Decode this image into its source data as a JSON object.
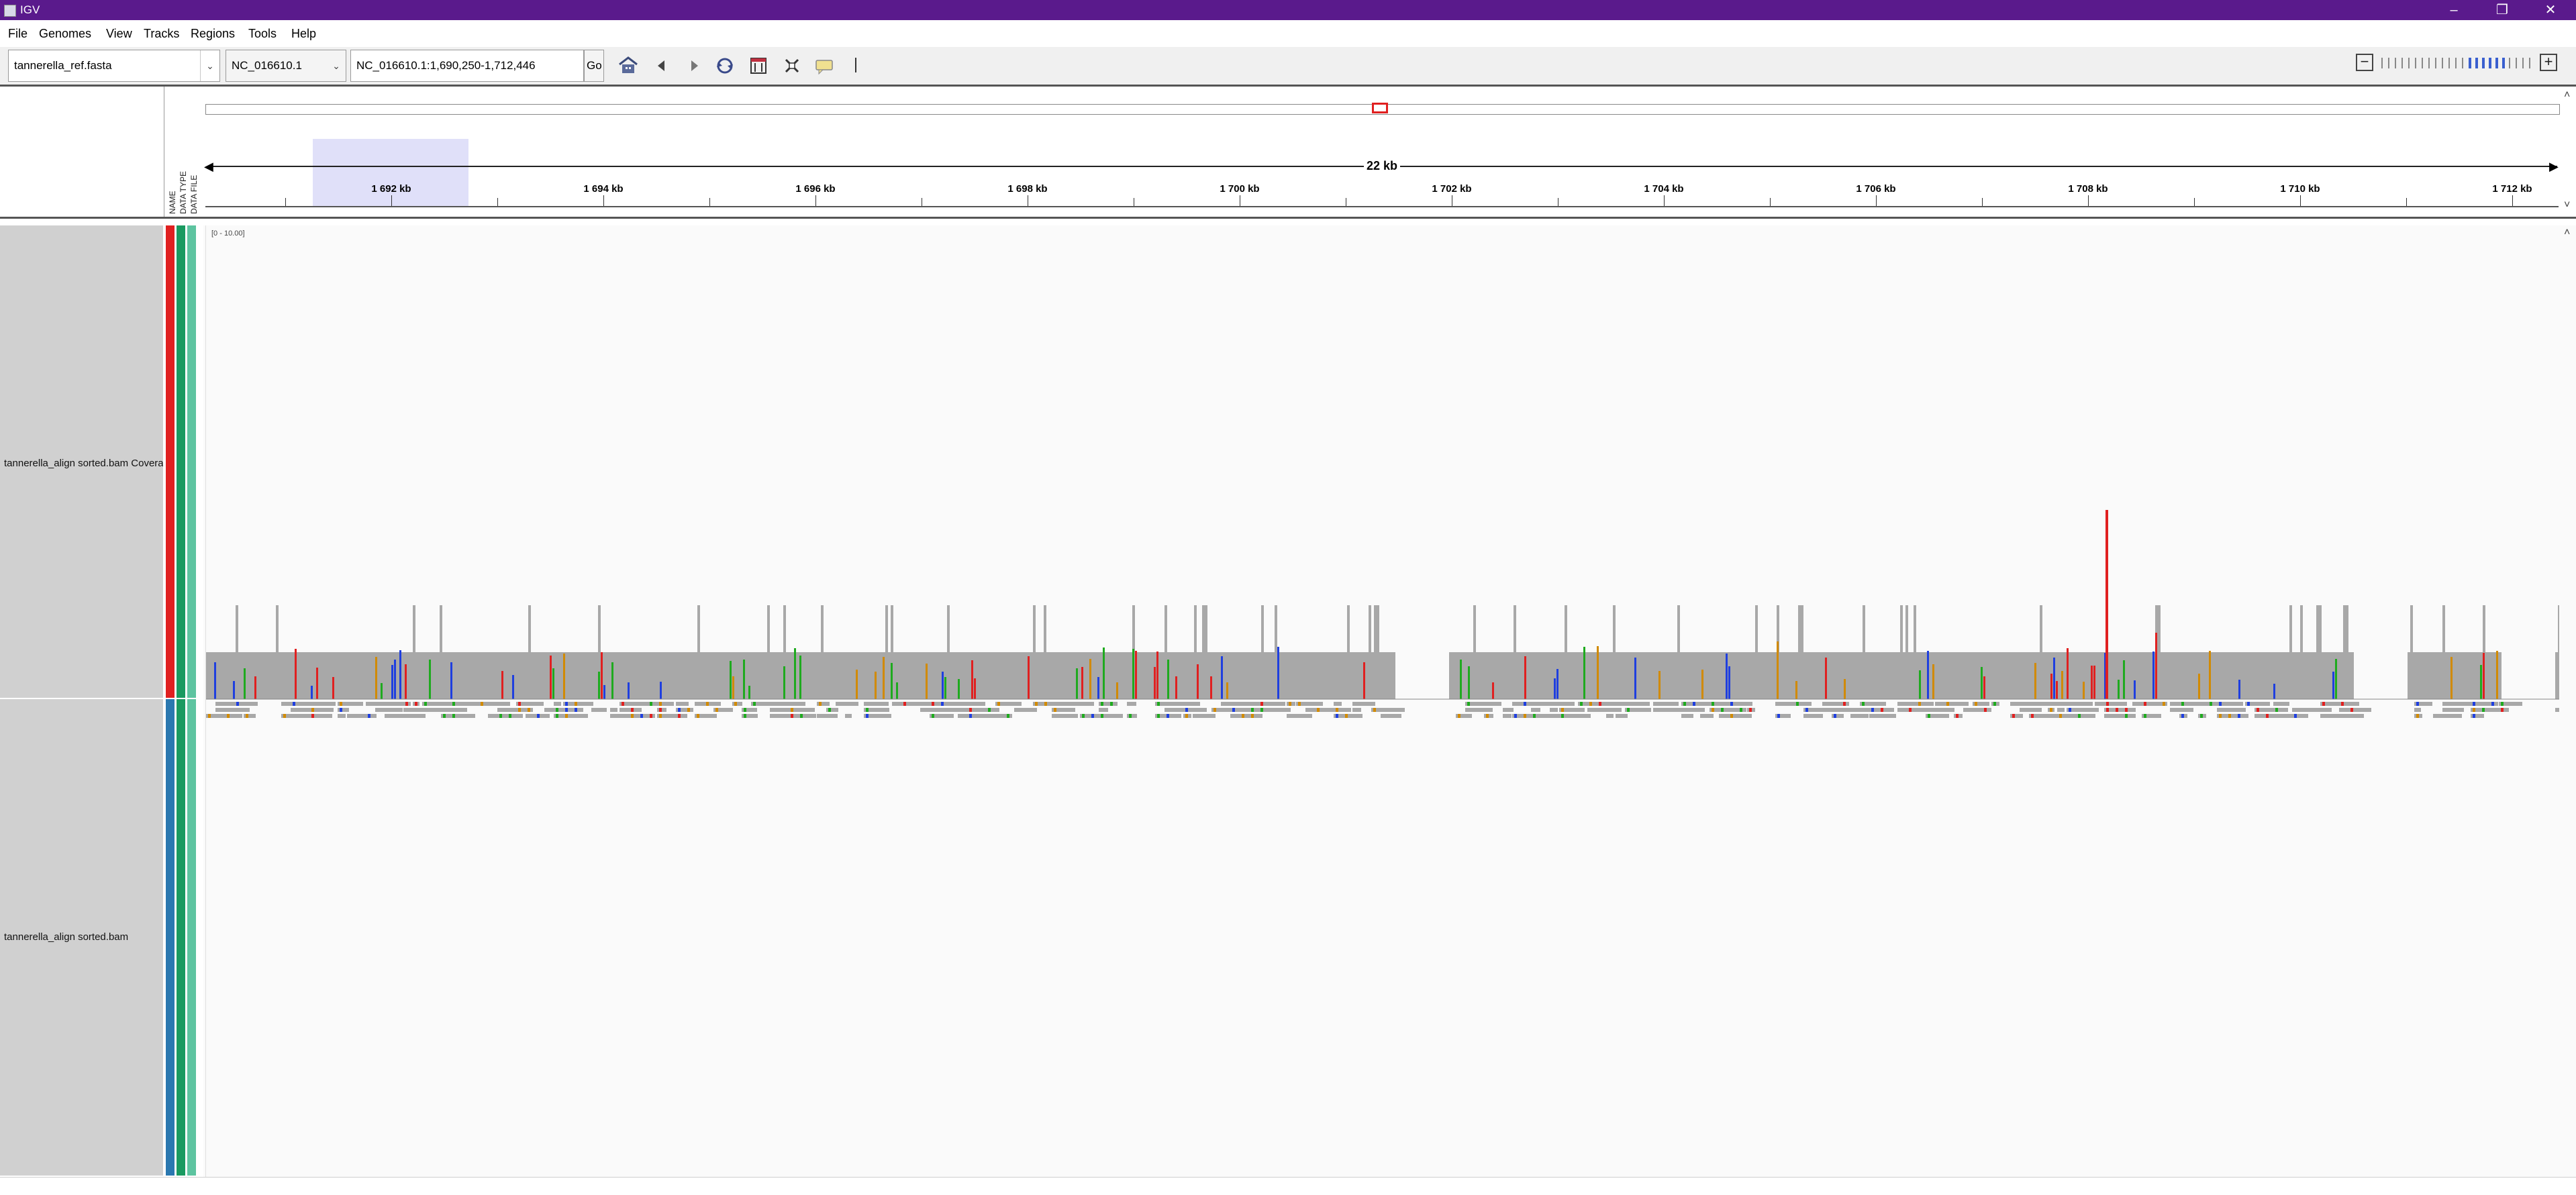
{
  "window": {
    "title": "IGV",
    "controls": [
      "minimize-icon",
      "restore-icon",
      "close-icon"
    ]
  },
  "menu": {
    "items": [
      "File",
      "Genomes",
      "View",
      "Tracks",
      "Regions",
      "Tools",
      "Help"
    ]
  },
  "toolbar": {
    "genome_value": "tannerella_ref.fasta",
    "chromosome_value": "NC_016610.1",
    "locus_value": "NC_016610.1:1,690,250-1,712,446",
    "go_label": "Go",
    "icons": [
      "home-icon",
      "back-icon",
      "forward-icon",
      "refresh-icon",
      "resize-to-window-icon",
      "region-of-interest-icon",
      "popup-text-icon",
      "roi-marker-icon"
    ],
    "zoom": {
      "levels": 23,
      "current_level": 14
    }
  },
  "header": {
    "attribute_labels": [
      "NAME",
      "DATA TYPE",
      "DATA FILE"
    ],
    "span_label": "22 kb",
    "ruler_labels": [
      "1 692 kb",
      "1 694 kb",
      "1 696 kb",
      "1 698 kb",
      "1 700 kb",
      "1 702 kb",
      "1 704 kb",
      "1 706 kb",
      "1 708 kb",
      "1 710 kb",
      "1 712 kb"
    ]
  },
  "tracks": [
    {
      "name": "tannerella_align sorted.bam Covera",
      "range": "[0 - 10.00]",
      "attribute_colors": [
        "#e02020",
        "#1a9a60",
        "#5dc4a0"
      ]
    },
    {
      "name": "tannerella_align sorted.bam",
      "attribute_colors": [
        "#2a78b0",
        "#1a9a60",
        "#5dc4a0"
      ]
    }
  ],
  "colors": {
    "titlebar": "#5a1a8c",
    "coverage_gray": "#a8a8a8",
    "roi_fill": "#d8d8f8",
    "base_A": "#1faa1f",
    "base_C": "#1f3fdf",
    "base_G": "#d18a00",
    "base_T": "#e02020"
  }
}
